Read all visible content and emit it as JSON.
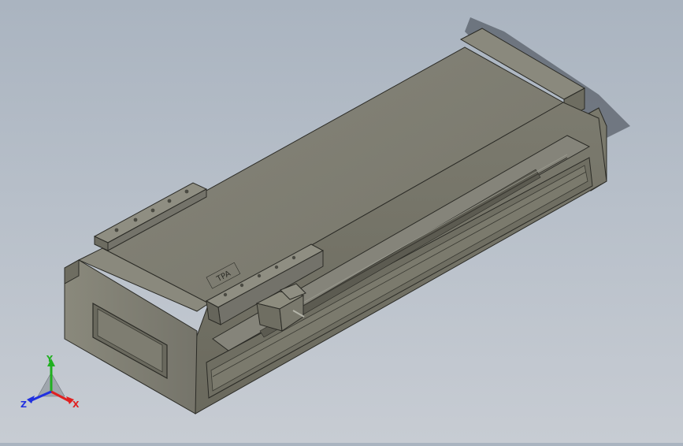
{
  "viewport": {
    "background_top": "#aab4c0",
    "background_bottom": "#c7ccd3"
  },
  "model": {
    "body_face_color": "#838274",
    "top_face_color": "#7f7e70",
    "side_face_color": "#6e6d61",
    "edge_color": "#2b2b26",
    "slider_color": "#8d8c7e",
    "logo_text": "TPA"
  },
  "triad": {
    "x_label": "X",
    "y_label": "Y",
    "z_label": "Z",
    "x_color": "#e02020",
    "y_color": "#20b020",
    "z_color": "#2030e0"
  }
}
